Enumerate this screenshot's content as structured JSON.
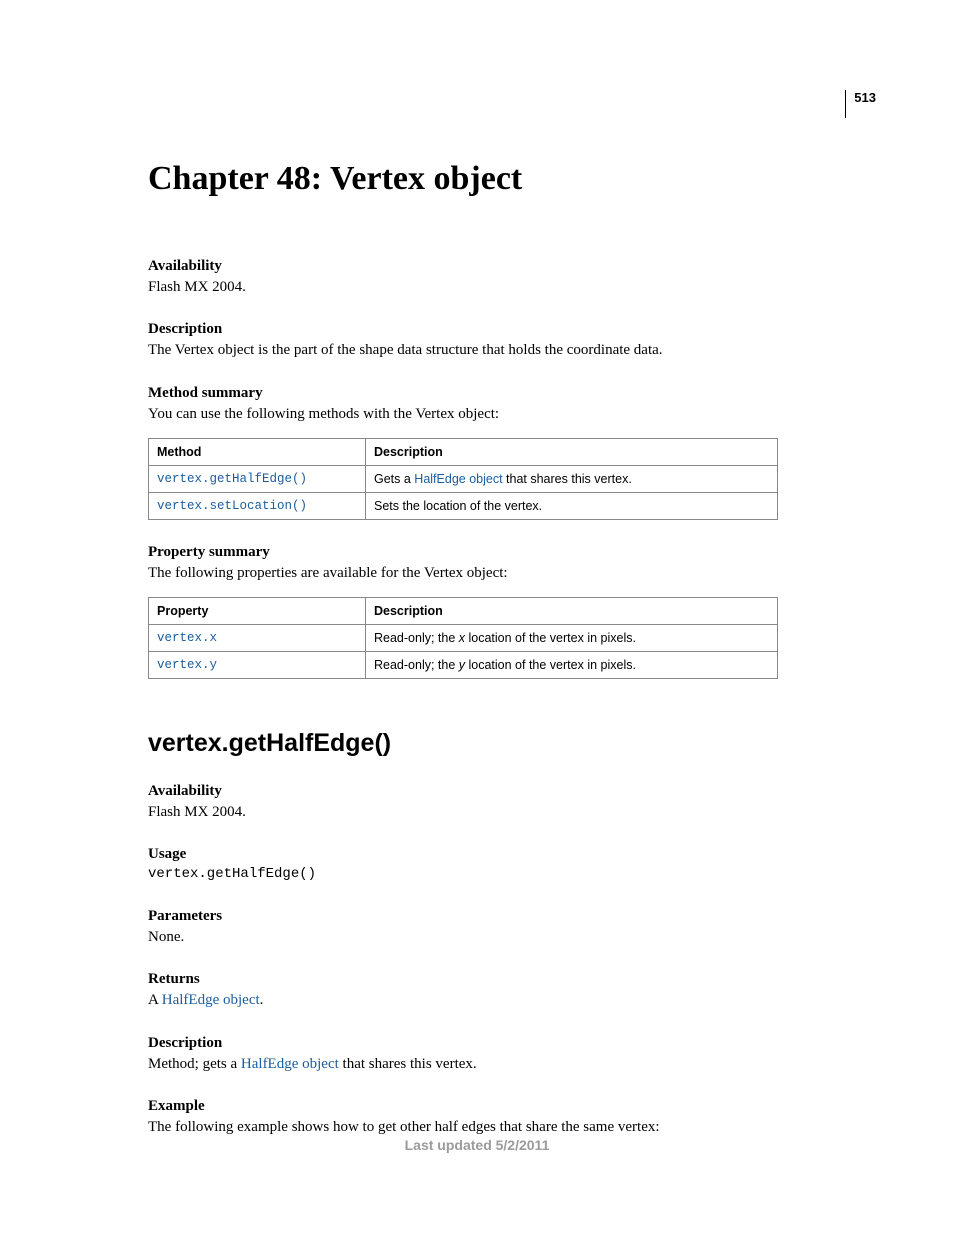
{
  "page_number": "513",
  "chapter_title": "Chapter 48: Vertex object",
  "availability": {
    "heading": "Availability",
    "text": "Flash MX 2004."
  },
  "description": {
    "heading": "Description",
    "text": "The Vertex object is the part of the shape data structure that holds the coordinate data."
  },
  "method_summary": {
    "heading": "Method summary",
    "intro": "You can use the following methods with the Vertex object:",
    "col1": "Method",
    "col2": "Description",
    "rows": [
      {
        "method": "vertex.getHalfEdge()",
        "desc_pre": "Gets a ",
        "desc_link": "HalfEdge object",
        "desc_post": " that shares this vertex."
      },
      {
        "method": "vertex.setLocation()",
        "desc_full": "Sets the location of the vertex."
      }
    ]
  },
  "property_summary": {
    "heading": "Property summary",
    "intro": "The following properties are available for the Vertex object:",
    "col1": "Property",
    "col2": "Description",
    "rows": [
      {
        "prop": "vertex.x",
        "desc_pre": "Read-only; the ",
        "desc_em": "x",
        "desc_post": " location of the vertex in pixels."
      },
      {
        "prop": "vertex.y",
        "desc_pre": "Read-only; the ",
        "desc_em": "y",
        "desc_post": " location of the vertex in pixels."
      }
    ]
  },
  "section": {
    "title": "vertex.getHalfEdge()",
    "availability": {
      "heading": "Availability",
      "text": "Flash MX 2004."
    },
    "usage": {
      "heading": "Usage",
      "code": "vertex.getHalfEdge()"
    },
    "parameters": {
      "heading": "Parameters",
      "text": "None."
    },
    "returns": {
      "heading": "Returns",
      "pre": "A ",
      "link": "HalfEdge object",
      "post": "."
    },
    "description2": {
      "heading": "Description",
      "pre": "Method; gets a ",
      "link": "HalfEdge object",
      "post": " that shares this vertex."
    },
    "example": {
      "heading": "Example",
      "text": "The following example shows how to get other half edges that share the same vertex:"
    }
  },
  "footer": "Last updated 5/2/2011"
}
